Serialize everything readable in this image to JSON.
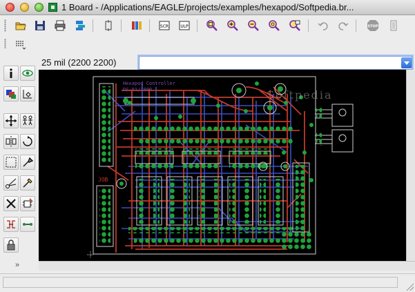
{
  "window": {
    "title": "1 Board - /Applications/EAGLE/projects/examples/hexapod/Softpedia.br..."
  },
  "toolbar": {
    "buttons": [
      {
        "name": "open-icon"
      },
      {
        "name": "save-icon"
      },
      {
        "name": "print-icon"
      },
      {
        "name": "cam-processor-icon"
      },
      {
        "name": "switch-schematic-icon"
      },
      {
        "name": "library-icon"
      },
      {
        "name": "script-icon"
      },
      {
        "name": "ulp-icon"
      },
      {
        "name": "zoom-fit-icon"
      },
      {
        "name": "zoom-in-icon"
      },
      {
        "name": "zoom-out-icon"
      },
      {
        "name": "zoom-redraw-icon"
      },
      {
        "name": "zoom-area-icon"
      },
      {
        "name": "undo-icon"
      },
      {
        "name": "redo-icon"
      },
      {
        "name": "stop-icon"
      },
      {
        "name": "go-icon"
      }
    ],
    "grid_label": "grid-icon"
  },
  "command_line": {
    "coordinates": "25 mil (2200 2200)",
    "value": ""
  },
  "palette": {
    "tools": [
      "info-icon",
      "show-icon",
      "display-layers-icon",
      "mark-icon",
      "move-icon",
      "copy-icon",
      "mirror-icon",
      "rotate-icon",
      "group-icon",
      "change-icon",
      "cut-icon",
      "paste-icon",
      "delete-icon",
      "add-icon",
      "pinswap-icon",
      "replace-icon",
      "lock-icon"
    ],
    "more": "»"
  },
  "board": {
    "labels": {
      "watermark": "Softpedia",
      "top_text_1": "Hexapod Controller",
      "top_text_2": "DS-01/1000",
      "left_label": "JOB"
    },
    "colors": {
      "background": "#000000",
      "top_layer": "#c0392b",
      "bottom_layer": "#3b4fc4",
      "pads": "#1fa33a",
      "outline": "#cfcfcf"
    }
  },
  "status": {
    "text": ""
  }
}
